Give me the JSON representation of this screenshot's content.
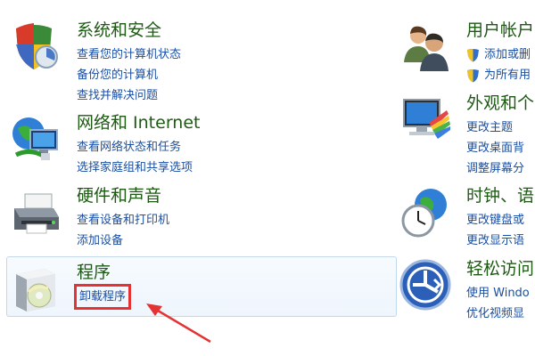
{
  "categories": {
    "system_security": {
      "title": "系统和安全",
      "links": [
        "查看您的计算机状态",
        "备份您的计算机",
        "查找并解决问题"
      ]
    },
    "network": {
      "title": "网络和 Internet",
      "links": [
        "查看网络状态和任务",
        "选择家庭组和共享选项"
      ]
    },
    "hardware": {
      "title": "硬件和声音",
      "links": [
        "查看设备和打印机",
        "添加设备"
      ]
    },
    "programs": {
      "title": "程序",
      "links": [
        "卸载程序"
      ]
    },
    "user_accounts": {
      "title": "用户帐户",
      "links": [
        "添加或删",
        "为所有用"
      ]
    },
    "appearance": {
      "title": "外观和个",
      "links": [
        "更改主题",
        "更改桌面背",
        "调整屏幕分"
      ]
    },
    "clock": {
      "title": "时钟、语",
      "links": [
        "更改键盘或",
        "更改显示语"
      ]
    },
    "ease": {
      "title": "轻松访问",
      "links": [
        "使用 Windo",
        "优化视频显"
      ]
    }
  },
  "colors": {
    "title": "#1e5a14",
    "link": "#1a4fa3",
    "highlight": "#e53333",
    "selected_bg": "#eef5fc"
  },
  "icons": {
    "system_security": "shield-icon",
    "network": "network-globe-icon",
    "hardware": "printer-icon",
    "programs": "software-box-icon",
    "user_accounts": "users-icon",
    "appearance": "monitor-palette-icon",
    "clock": "clock-globe-icon",
    "ease": "accessibility-icon",
    "annotation": "red-arrow-icon"
  }
}
